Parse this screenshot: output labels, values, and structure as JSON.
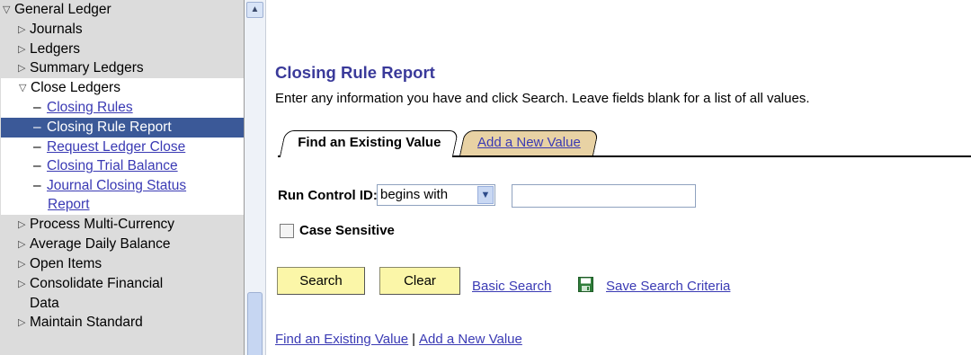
{
  "nav": {
    "root": "General Ledger",
    "items_before": [
      "Journals",
      "Ledgers",
      "Summary Ledgers"
    ],
    "open_group": "Close Ledgers",
    "sub_items": [
      {
        "label": "Closing Rules",
        "selected": false
      },
      {
        "label": "Closing Rule Report",
        "selected": true
      },
      {
        "label": "Request Ledger Close",
        "selected": false
      },
      {
        "label": "Closing Trial Balance",
        "selected": false
      },
      {
        "label": "Journal Closing Status",
        "label2": "Report",
        "selected": false
      }
    ],
    "items_after": [
      "Process Multi-Currency",
      "Average Daily Balance",
      "Open Items"
    ],
    "consolidate": {
      "line1": "Consolidate Financial",
      "line2": "Data"
    },
    "last_item": "Maintain Standard"
  },
  "page": {
    "title": "Closing Rule Report",
    "instructions": "Enter any information you have and click Search. Leave fields blank for a list of all values."
  },
  "tabs": {
    "find": "Find an Existing Value",
    "add": "Add a New Value"
  },
  "form": {
    "run_control_label": "Run Control ID:",
    "operator": "begins with",
    "run_control_value": "",
    "case_sensitive_label": "Case Sensitive",
    "case_sensitive_checked": false
  },
  "buttons": {
    "search": "Search",
    "clear": "Clear",
    "basic_search": "Basic Search",
    "save_criteria": "Save Search Criteria"
  },
  "bottom_links": {
    "find": "Find an Existing Value",
    "separator": "|",
    "add": "Add a New Value"
  },
  "colors": {
    "nav_bg": "#dcdcdc",
    "selected_bg": "#3b5998",
    "link": "#3a3ab4",
    "title": "#3a3a9a",
    "button_bg": "#fbf6a8",
    "tab_inactive_bg": "#e8d2a4"
  },
  "icons": {
    "tree_open": "triangle-down-icon",
    "tree_closed": "triangle-right-icon",
    "save": "floppy-disk-icon",
    "dropdown": "chevron-down-icon",
    "scroll_up": "chevron-up-icon"
  }
}
